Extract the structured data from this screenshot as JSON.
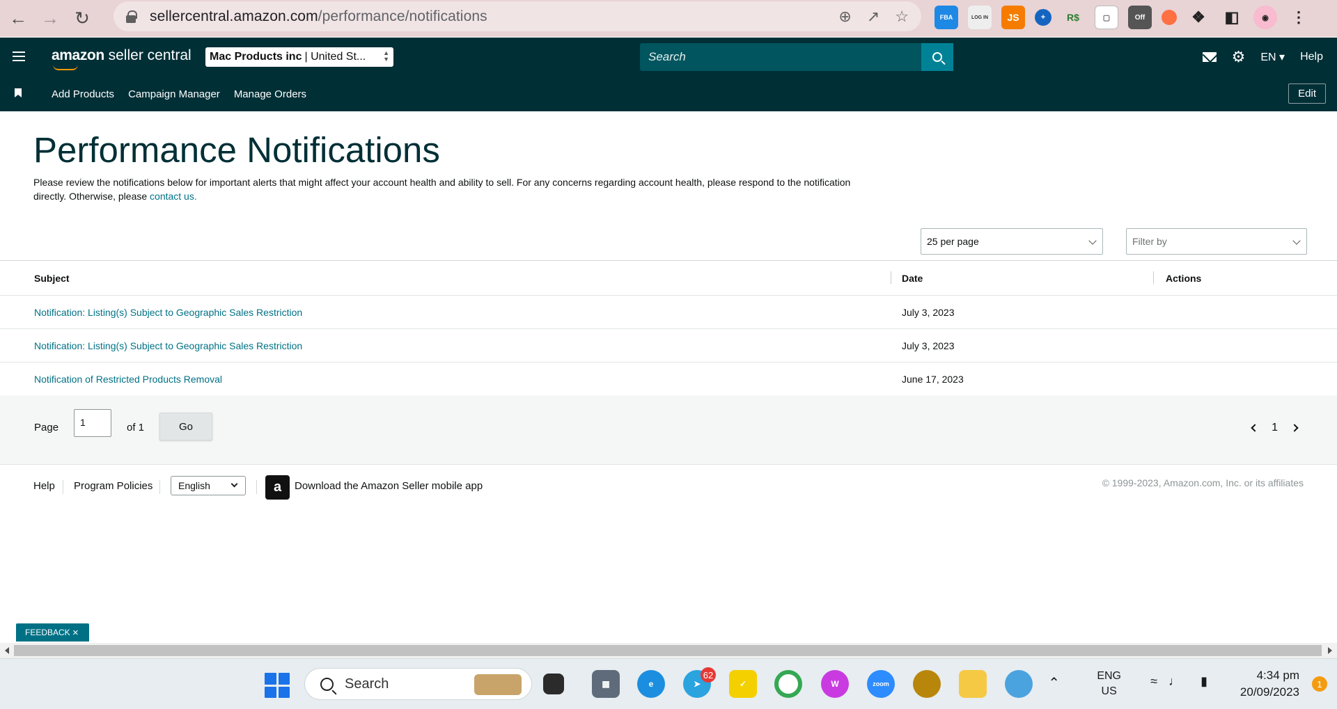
{
  "browser": {
    "url_domain": "sellercentral.amazon.com",
    "url_path": "/performance/notifications",
    "extension_off_label": "Off"
  },
  "header": {
    "brand_bold": "amazon",
    "brand_rest": " seller central",
    "store_name": "Mac Products inc",
    "store_region": "| United St...",
    "search_placeholder": "Search",
    "language": "EN",
    "help": "Help"
  },
  "subnav": {
    "links": [
      "Add Products",
      "Campaign Manager",
      "Manage Orders"
    ],
    "edit_label": "Edit"
  },
  "page": {
    "title": "Performance Notifications",
    "description": "Please review the notifications below for important alerts that might affect your account health and ability to sell. For any concerns regarding account health, please respond to the notification directly. Otherwise, please ",
    "contact_link": "contact us.",
    "per_page": "25 per page",
    "filter_placeholder": "Filter by"
  },
  "table": {
    "headers": [
      "Subject",
      "Date",
      "Actions"
    ],
    "rows": [
      {
        "subject": "Notification: Listing(s) Subject to Geographic Sales Restriction",
        "date": "July 3, 2023"
      },
      {
        "subject": "Notification: Listing(s) Subject to Geographic Sales Restriction",
        "date": "July 3, 2023"
      },
      {
        "subject": "Notification of Restricted Products Removal",
        "date": "June 17, 2023"
      }
    ]
  },
  "pagination": {
    "page_label": "Page",
    "page_value": "1",
    "of_label": "of 1",
    "go_label": "Go",
    "current_page": "1"
  },
  "footer": {
    "help": "Help",
    "policies": "Program Policies",
    "language": "English",
    "app_text": "Download the Amazon Seller mobile app",
    "copyright": "© 1999-2023, Amazon.com, Inc. or its affiliates"
  },
  "feedback": {
    "label": "FEEDBACK",
    "close": "×"
  },
  "taskbar": {
    "search_label": "Search",
    "telegram_badge": "62",
    "lang_line1": "ENG",
    "lang_line2": "US",
    "time": "4:34 pm",
    "date": "20/09/2023",
    "notification_count": "1",
    "zoom_label": "zoom"
  },
  "colors": {
    "header_bg": "#002f36",
    "search_bg": "#00555e",
    "search_btn": "#008296",
    "link": "#007185",
    "title": "#002f36"
  }
}
